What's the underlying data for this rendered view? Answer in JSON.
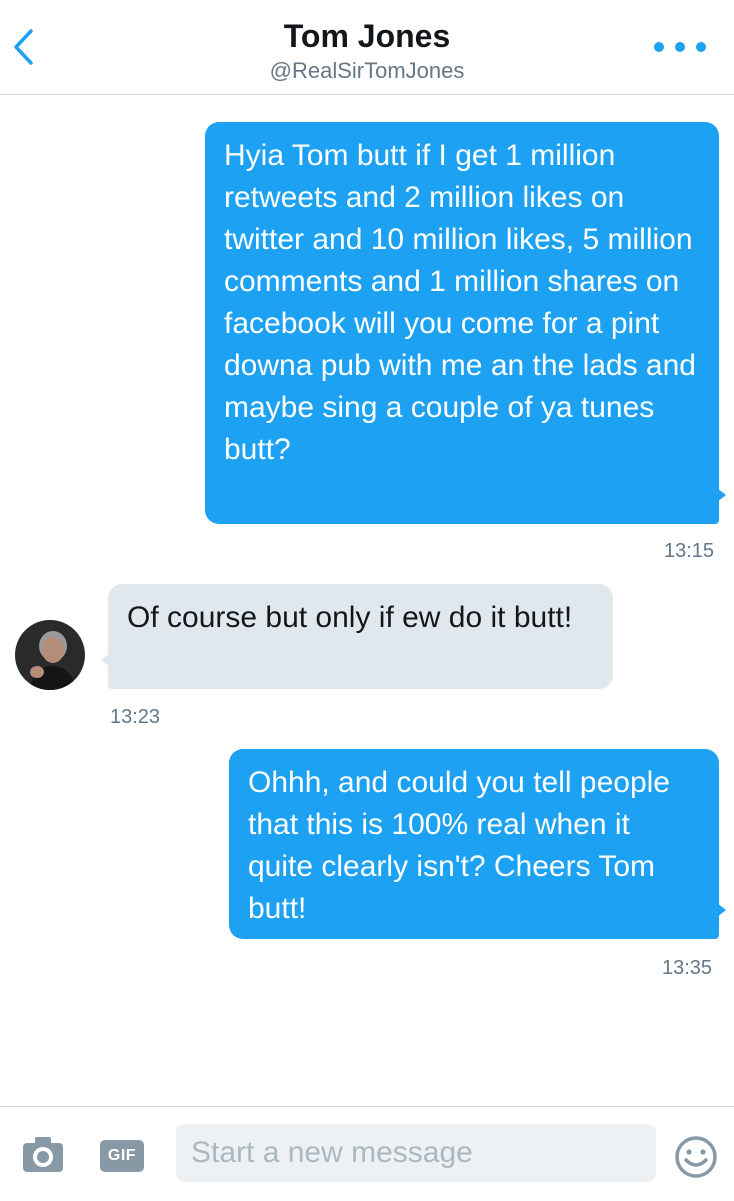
{
  "header": {
    "title": "Tom Jones",
    "handle": "@RealSirTomJones",
    "back_icon": "chevron-left-icon",
    "more_icon": "more-dots-icon",
    "accent_color": "#1da1f2"
  },
  "messages": [
    {
      "direction": "outgoing",
      "text": "Hyia Tom butt if I get 1 million retweets and 2 million likes on twitter and 10 million likes, 5 million comments and 1 million shares on facebook will you come for a pint downa pub with me an the lads and maybe sing a couple of ya tunes butt?",
      "time": "13:15"
    },
    {
      "direction": "incoming",
      "text": "Of course but only if ew do it butt!",
      "time": "13:23"
    },
    {
      "direction": "outgoing",
      "text": "Ohhh, and could you tell people that this is 100% real when it quite clearly isn't? Cheers Tom butt!",
      "time": "13:35"
    }
  ],
  "composer": {
    "placeholder": "Start a new message",
    "gif_label": "GIF",
    "camera_icon": "camera-icon",
    "emoji_icon": "emoji-icon"
  },
  "colors": {
    "outgoing_bubble": "#1da1f2",
    "incoming_bubble": "#e1e8ed",
    "timestamp": "#657786"
  }
}
